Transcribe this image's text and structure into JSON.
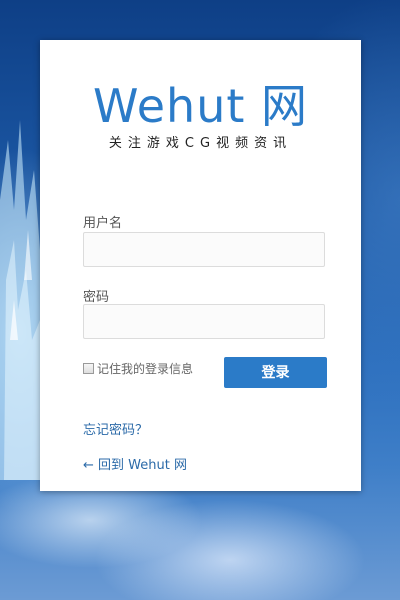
{
  "brand": {
    "logo_text": "Wehut 网",
    "tagline": "关注游戏CG视频资讯",
    "accent_color": "#2b7bc8"
  },
  "form": {
    "username_label": "用户名",
    "username_value": "",
    "password_label": "密码",
    "password_value": "",
    "remember_label": "记住我的登录信息",
    "remember_checked": false,
    "submit_label": "登录"
  },
  "links": {
    "forgot_password": "忘记密码？",
    "back_to_site": "← 回到 Wehut 网"
  }
}
